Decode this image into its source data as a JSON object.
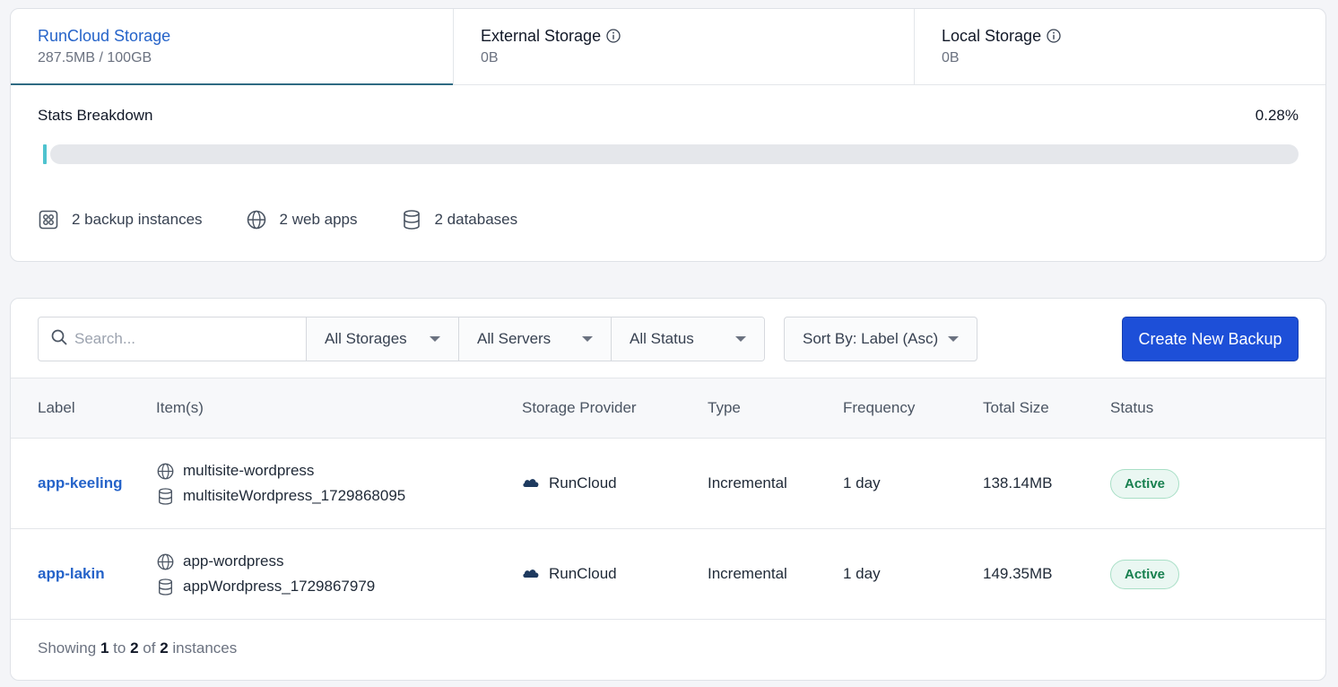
{
  "storage_tabs": [
    {
      "title": "RunCloud Storage",
      "sub": "287.5MB / 100GB"
    },
    {
      "title": "External Storage",
      "sub": "0B"
    },
    {
      "title": "Local Storage",
      "sub": "0B"
    }
  ],
  "stats": {
    "title": "Stats Breakdown",
    "percent_label": "0.28%",
    "usage_fraction": 0.0028,
    "backup_instances": "2 backup instances",
    "web_apps": "2 web apps",
    "databases": "2 databases"
  },
  "toolbar": {
    "search_placeholder": "Search...",
    "filter_storage": "All Storages",
    "filter_servers": "All Servers",
    "filter_status": "All Status",
    "sort_label": "Sort By: Label (Asc)",
    "create_button": "Create New Backup"
  },
  "table": {
    "columns": [
      "Label",
      "Item(s)",
      "Storage Provider",
      "Type",
      "Frequency",
      "Total Size",
      "Status"
    ],
    "rows": [
      {
        "label": "app-keeling",
        "webapp": "multisite-wordpress",
        "database": "multisiteWordpress_1729868095",
        "provider": "RunCloud",
        "type": "Incremental",
        "frequency": "1 day",
        "size": "138.14MB",
        "status": "Active"
      },
      {
        "label": "app-lakin",
        "webapp": "app-wordpress",
        "database": "appWordpress_1729867979",
        "provider": "RunCloud",
        "type": "Incremental",
        "frequency": "1 day",
        "size": "149.35MB",
        "status": "Active"
      }
    ]
  },
  "pagination": {
    "prefix": "Showing",
    "from": "1",
    "to_word": "to",
    "to": "2",
    "of_word": "of",
    "total": "2",
    "suffix": "instances"
  },
  "colors": {
    "accent": "#2563c9",
    "primary_button": "#1d4fd8",
    "active_badge": "#17804f",
    "usage_bar": "#4fc3cf"
  },
  "icons": {
    "info": "info-icon",
    "backup": "backup-instances-icon",
    "webapp": "globe-icon",
    "database": "database-icon",
    "search": "search-icon",
    "cloud": "cloud-icon"
  }
}
